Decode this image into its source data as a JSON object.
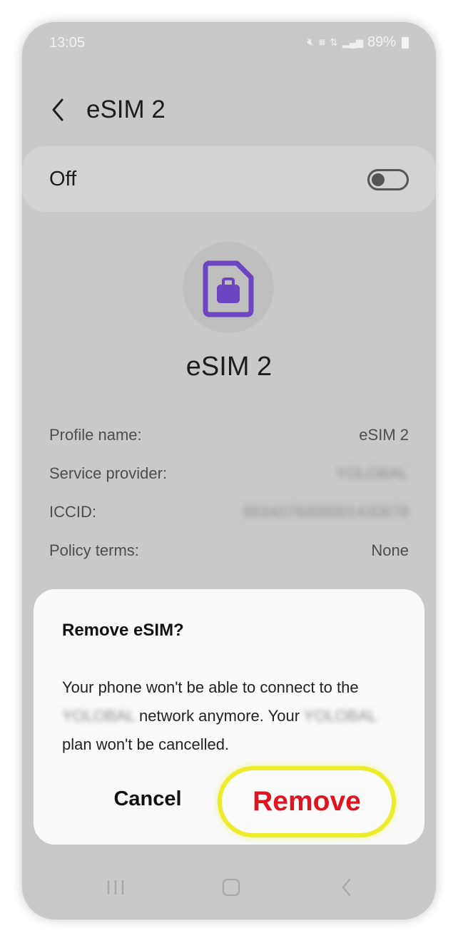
{
  "status_bar": {
    "time": "13:05",
    "mute_icon": "mute-icon",
    "network_icons": "volte-lte-icon",
    "signal_icon": "signal-icon",
    "battery": "89%"
  },
  "header": {
    "title": "eSIM 2",
    "back_icon": "chevron-left-icon"
  },
  "toggle": {
    "label": "Off",
    "enabled": false
  },
  "sim": {
    "icon": "sim-card-icon",
    "accent_color": "#6b45c2",
    "name": "eSIM 2"
  },
  "info": [
    {
      "label": "Profile name:",
      "value": "eSIM 2"
    },
    {
      "label": "Service provider:",
      "value": "YOLOBAL"
    },
    {
      "label": "ICCID:",
      "value": "8934076000001430678"
    },
    {
      "label": "Policy terms:",
      "value": "None"
    }
  ],
  "dialog": {
    "title": "Remove eSIM?",
    "body_1": "Your phone won't be able to connect to the",
    "provider_1": "YOLOBAL",
    "body_2": "network anymore. Your",
    "provider_2": "YOLOBAL",
    "body_3": "plan won't be cancelled.",
    "cancel_label": "Cancel",
    "remove_label": "Remove",
    "remove_color": "#e1131f",
    "highlight_color": "#ecec2d"
  },
  "nav_bar": {
    "recent_icon": "recent-apps-icon",
    "home_icon": "home-icon",
    "back_icon": "back-icon"
  }
}
